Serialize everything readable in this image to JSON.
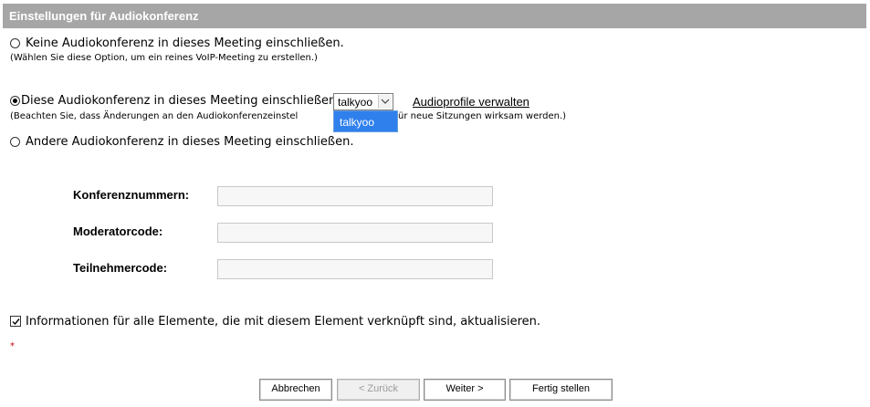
{
  "header": {
    "title": "Einstellungen für Audiokonferenz"
  },
  "options": {
    "none": {
      "label": "Keine Audiokonferenz in dieses Meeting einschließen.",
      "hint": "(Wählen Sie diese Option, um ein reines VoIP-Meeting zu erstellen.)",
      "selected": false
    },
    "this": {
      "label": "Diese Audiokonferenz in dieses Meeting einschließen:",
      "hint": "(Beachten Sie, dass Änderungen an den Audiokonferenzeinstel",
      "hint_tail": "ür neue Sitzungen wirksam werden.)",
      "selected": true,
      "select_value": "talkyoo",
      "dropdown_options": [
        "talkyoo"
      ],
      "manage_link": "Audioprofile verwalten"
    },
    "other": {
      "label": "Andere Audiokonferenz in dieses Meeting einschließen.",
      "selected": false
    }
  },
  "fields": {
    "conference_numbers": {
      "label": "Konferenznummern:",
      "value": ""
    },
    "moderator_code": {
      "label": "Moderatorcode:",
      "value": ""
    },
    "participant_code": {
      "label": "Teilnehmercode:",
      "value": ""
    }
  },
  "update_checkbox": {
    "label": "Informationen für alle Elemente, die mit diesem Element verknüpft sind, aktualisieren.",
    "checked": true
  },
  "required_marker": "*",
  "buttons": {
    "cancel": "Abbrechen",
    "back": "< Zurück",
    "next": "Weiter >",
    "finish": "Fertig stellen"
  },
  "colors": {
    "header_bg": "#a6a6a6",
    "dropdown_highlight": "#2f80ed",
    "required": "#d00000"
  }
}
